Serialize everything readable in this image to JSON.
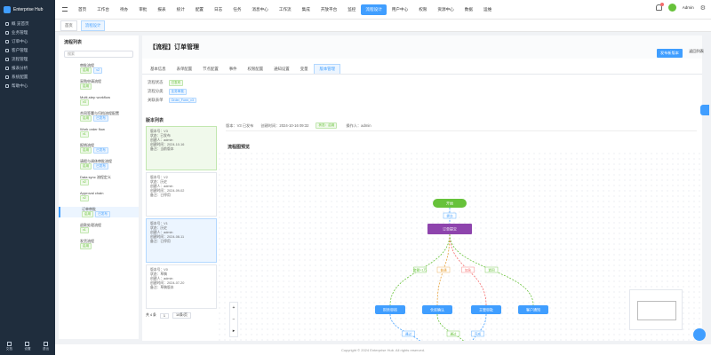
{
  "app": {
    "name": "Enterprise Hub"
  },
  "sidebar": {
    "items": [
      {
        "label": "概 览首页"
      },
      {
        "label": "业务管理"
      },
      {
        "label": "订单中心"
      },
      {
        "label": "客户管理"
      },
      {
        "label": "流程管理"
      },
      {
        "label": "报表分析"
      },
      {
        "label": "系统配置"
      },
      {
        "label": "帮助中心"
      }
    ],
    "footer": [
      {
        "label": "文档"
      },
      {
        "label": "设置"
      },
      {
        "label": "退出"
      }
    ]
  },
  "topnav": {
    "items": [
      "首页",
      "工作台",
      "待办",
      "审批",
      "报表",
      "统计",
      "配置",
      "日志",
      "任务",
      "消息中心",
      "工作流",
      "集成",
      "开放平台",
      "监控",
      "流程设计",
      "用户中心",
      "权限",
      "资源中心",
      "数据",
      "运维"
    ],
    "active_index": 14
  },
  "user": {
    "name": "Admin"
  },
  "tabs": [
    {
      "label": "首页"
    },
    {
      "label": "流程设计"
    }
  ],
  "tree": {
    "title": "流程列表",
    "search_placeholder": "搜索",
    "nodes": [
      {
        "text": "审批流程",
        "tags": [
          "启用",
          "v2"
        ]
      },
      {
        "text": "采购申请流程",
        "tags": [
          "启用"
        ]
      },
      {
        "text": "Multi-step workflow",
        "tags": [
          "v3"
        ]
      },
      {
        "text": "合同签署与归档流程配置",
        "tags": [
          "启用",
          "已发布"
        ]
      },
      {
        "text": "Work order flow",
        "tags": [
          "v1"
        ]
      },
      {
        "text": "报销流程",
        "tags": [
          "启用",
          "已发布"
        ]
      },
      {
        "text": "请假与调休审批流程",
        "tags": [
          "启用",
          "已发布"
        ]
      },
      {
        "text": "Data sync 流程定义",
        "tags": [
          "v2"
        ]
      },
      {
        "text": "Approval chain",
        "tags": [
          "v2"
        ]
      },
      {
        "text": "订单审批",
        "tags": [
          "启用",
          "已发布"
        ],
        "selected": true
      },
      {
        "text": "退款处理流程",
        "tags": [
          "v1"
        ]
      },
      {
        "text": "发货流程",
        "tags": [
          "启用"
        ]
      }
    ]
  },
  "page": {
    "title": "【流程】订单管理",
    "subtabs": [
      "基本信息",
      "表单配置",
      "节点配置",
      "事件",
      "权限配置",
      "通知设置",
      "变量",
      "版本管理"
    ],
    "subtab_active": 7,
    "info": [
      {
        "label": "流程状态",
        "value": "已发布"
      },
      {
        "label": "流程分类",
        "value": "业务审批"
      },
      {
        "label": "关联表单",
        "value": "Order_Form_v3"
      }
    ],
    "primary_button": "发布新版本",
    "text_button": "返回列表"
  },
  "versions": {
    "title": "版本列表",
    "cards": [
      {
        "lines": [
          "版本号：V3",
          "状态：已发布",
          "创建人：admin",
          "创建时间：2024-10-16",
          "备注：当前版本"
        ]
      },
      {
        "lines": [
          "版本号：V2",
          "状态：历史",
          "创建人：admin",
          "创建时间：2024-09-02",
          "备注：已停用"
        ]
      },
      {
        "lines": [
          "版本号：V1",
          "状态：历史",
          "创建人：admin",
          "创建时间：2024-08-11",
          "备注：已停用"
        ]
      },
      {
        "lines": [
          "版本号：V0",
          "状态：草稿",
          "创建人：admin",
          "创建时间：2024-07-20",
          "备注：草稿版本"
        ]
      }
    ],
    "pager": {
      "total": "共 4 条",
      "page": "1",
      "size": "10条/页"
    }
  },
  "flow": {
    "meta": [
      "版本：V3 已发布",
      "创建时间：2024-10-16 09:32",
      "状态：启用",
      "操作人：admin"
    ],
    "title": "流程图预览",
    "nodes": [
      {
        "label": "开始"
      },
      {
        "label": "订单提交"
      },
      {
        "label": "财务审核"
      },
      {
        "label": "仓库确认"
      },
      {
        "label": "主管审批"
      },
      {
        "label": "客户通知"
      },
      {
        "label": "结束"
      },
      {
        "label": "归档"
      }
    ],
    "edge_labels": [
      "提交",
      "金额>1万",
      "普通",
      "加急",
      "退回",
      "通过",
      "通过",
      "完成"
    ]
  },
  "footer": {
    "text": "Copyright © 2024 Enterprise Hub. All rights reserved."
  }
}
